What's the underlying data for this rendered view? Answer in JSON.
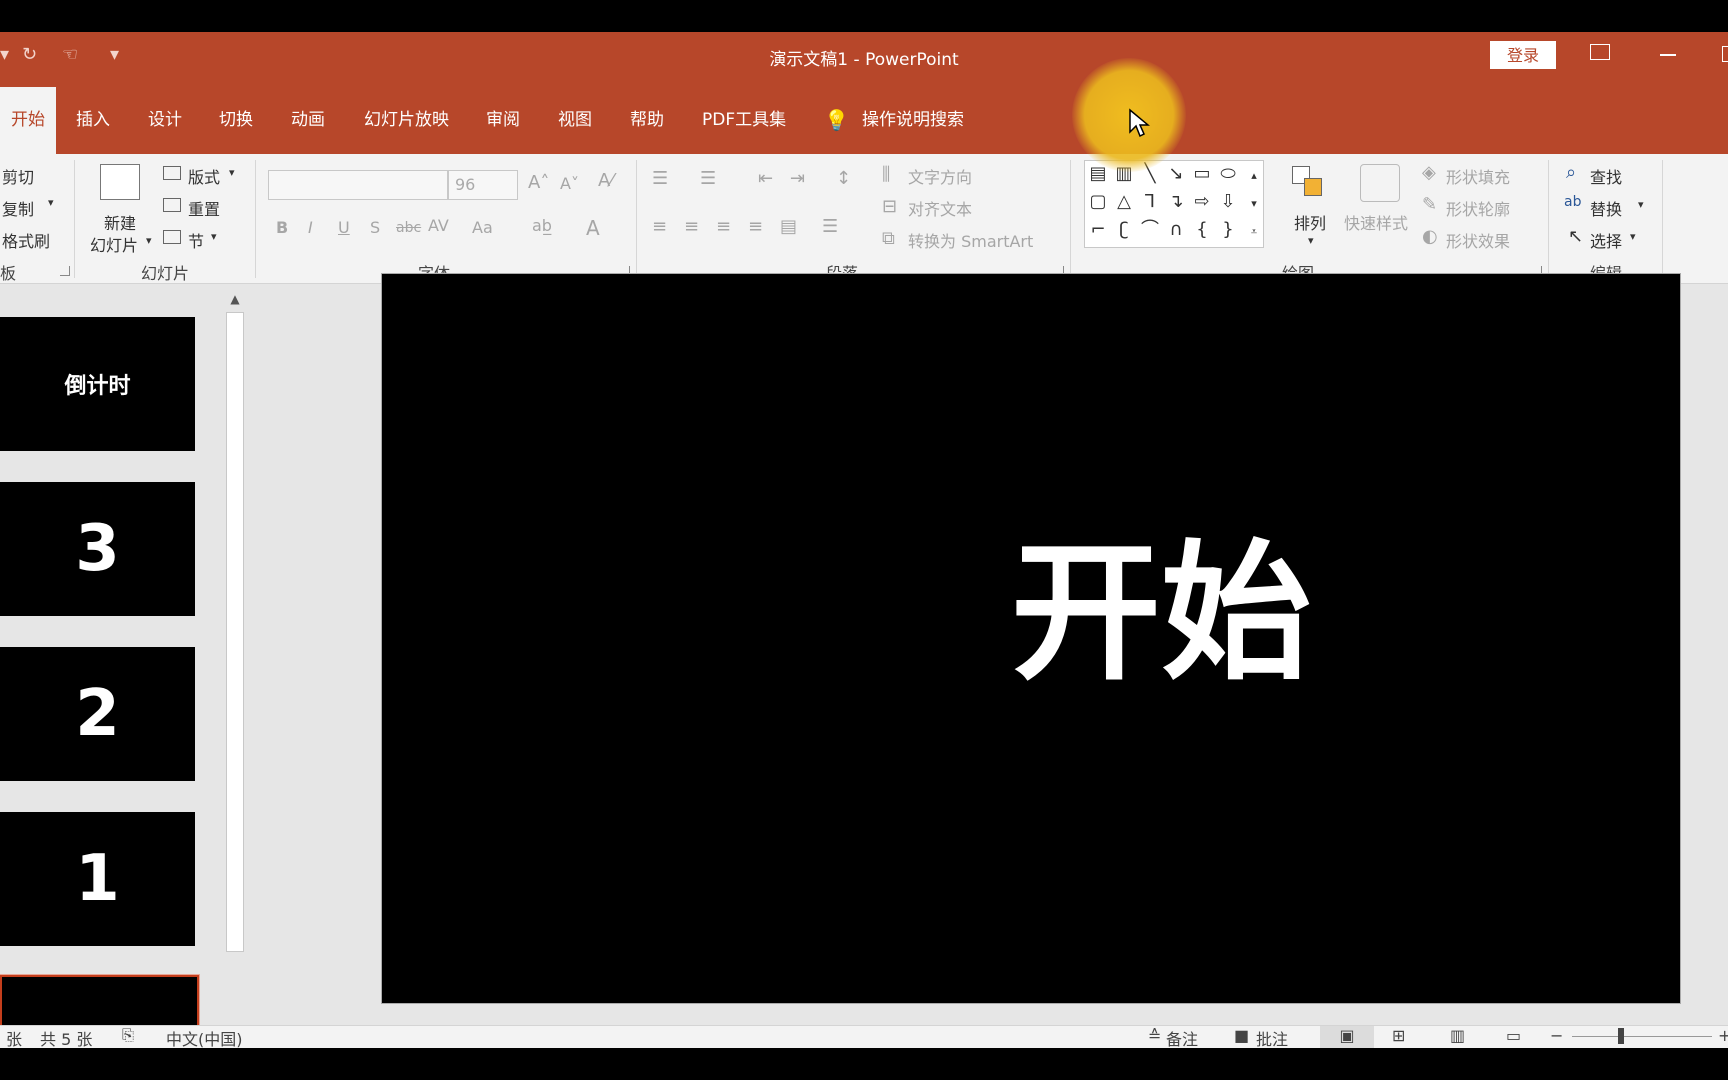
{
  "title_bar": {
    "document_title": "演示文稿1 - PowerPoint",
    "login_label": "登录",
    "quick_access": [
      "undo-icon",
      "redo-icon",
      "touch-mode-icon",
      "customize-icon"
    ]
  },
  "tabs": [
    {
      "label": "开始",
      "active": true
    },
    {
      "label": "插入"
    },
    {
      "label": "设计"
    },
    {
      "label": "切换"
    },
    {
      "label": "动画"
    },
    {
      "label": "幻灯片放映"
    },
    {
      "label": "审阅"
    },
    {
      "label": "视图"
    },
    {
      "label": "帮助"
    },
    {
      "label": "PDF工具集"
    },
    {
      "label": "操作说明搜索"
    }
  ],
  "ribbon": {
    "clipboard": {
      "cut": "剪切",
      "copy": "复制",
      "format_painter": "格式刷",
      "group_label": "板"
    },
    "slides": {
      "new_slide_line1": "新建",
      "new_slide_line2": "幻灯片",
      "layout": "版式",
      "reset": "重置",
      "section": "节",
      "group_label": "幻灯片"
    },
    "font": {
      "font_name": "",
      "font_size": "96",
      "bold": "B",
      "italic": "I",
      "underline": "U",
      "shadow": "S",
      "strike": "abc",
      "spacing": "AV",
      "case": "Aa",
      "color": "A",
      "group_label": "字体"
    },
    "paragraph": {
      "text_direction": "文字方向",
      "align_text": "对齐文本",
      "convert_smartart": "转换为 SmartArt",
      "group_label": "段落"
    },
    "drawing": {
      "arrange": "排列",
      "quick_styles": "快速样式",
      "shape_fill": "形状填充",
      "shape_outline": "形状轮廓",
      "shape_effects": "形状效果",
      "group_label": "绘图"
    },
    "editing": {
      "find": "查找",
      "replace": "替换",
      "select": "选择",
      "group_label": "编辑"
    }
  },
  "thumbnails": [
    {
      "text": "倒计时"
    },
    {
      "text": "3"
    },
    {
      "text": "2"
    },
    {
      "text": "1"
    },
    {
      "text": "开始",
      "selected": true
    }
  ],
  "slide": {
    "text": "开始"
  },
  "status_bar": {
    "slide_info_a": "张",
    "slide_info_b": "共 5 张",
    "language": "中文(中国)",
    "notes": "备注",
    "comments": "批注"
  },
  "colors": {
    "accent": "#b7472a",
    "ribbon_bg": "#f3f3f3",
    "slide_bg": "#000000"
  }
}
